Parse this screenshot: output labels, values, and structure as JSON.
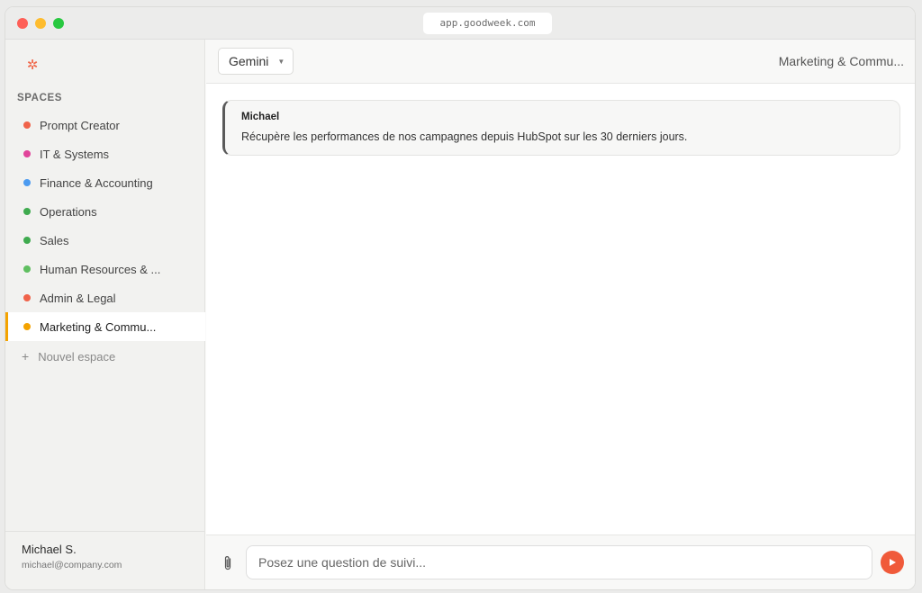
{
  "browser": {
    "url": "app.goodweek.com"
  },
  "sidebar": {
    "logo_icon": "sun-gear-icon",
    "spaces_title": "SPACES",
    "spaces": [
      {
        "label": "Prompt Creator",
        "color": "#f0634a"
      },
      {
        "label": "IT & Systems",
        "color": "#e1449a"
      },
      {
        "label": "Finance & Accounting",
        "color": "#4c9bf0"
      },
      {
        "label": "Operations",
        "color": "#3fab4f"
      },
      {
        "label": "Sales",
        "color": "#3fab4f"
      },
      {
        "label": "Human Resources & ...",
        "color": "#5fbf60"
      },
      {
        "label": "Admin & Legal",
        "color": "#f0634a"
      },
      {
        "label": "Marketing & Commu...",
        "color": "#f4a300",
        "active": true
      }
    ],
    "new_space_label": "Nouvel espace",
    "user": {
      "name": "Michael S.",
      "email": "michael@company.com"
    }
  },
  "header": {
    "model": "Gemini",
    "space_title": "Marketing & Commu..."
  },
  "conversation": {
    "messages": [
      {
        "author": "Michael",
        "text": "Récupère les performances de nos campagnes depuis HubSpot sur les 30 derniers jours."
      }
    ]
  },
  "composer": {
    "placeholder": "Posez une question de suivi...",
    "attach_icon": "paperclip-icon",
    "send_icon": "play-send-icon",
    "send_color": "#f05a3a"
  }
}
